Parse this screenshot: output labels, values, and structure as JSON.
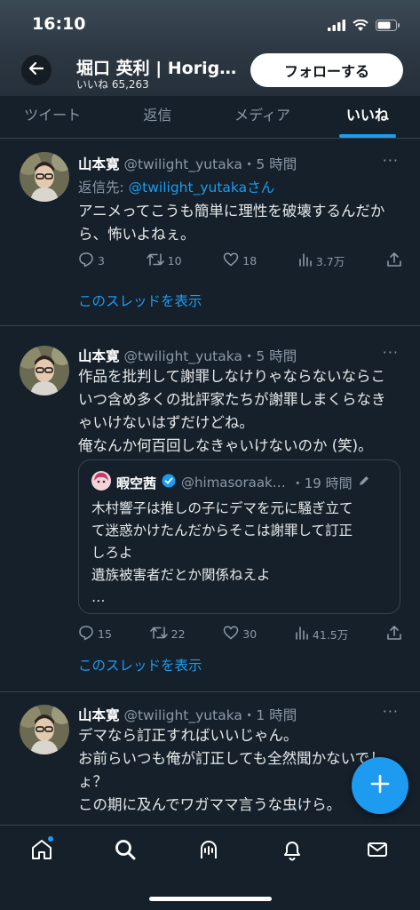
{
  "status_bar": {
    "time": "16:10"
  },
  "header": {
    "profile_name": "堀口 英利 | Horig…",
    "likes_label": "いいね 65,263",
    "follow_label": "フォローする"
  },
  "tabs": [
    {
      "label": "ツイート",
      "active": false
    },
    {
      "label": "返信",
      "active": false
    },
    {
      "label": "メディア",
      "active": false
    },
    {
      "label": "いいね",
      "active": true
    }
  ],
  "tweets": [
    {
      "name": "山本寛",
      "handle": "@twilight_yutaka",
      "time": "・5 時間",
      "more": "···",
      "reply_prefix": "返信先: ",
      "reply_handle": "@twilight_yutakaさん",
      "lines": [
        "アニメってこうも簡単に理性を破壊するんだか",
        "ら、怖いよねぇ。"
      ],
      "replies": "3",
      "retweets": "10",
      "likes": "18",
      "views": "3.7万",
      "thread_label": "このスレッドを表示"
    },
    {
      "name": "山本寛",
      "handle": "@twilight_yutaka",
      "time": "・5 時間",
      "more": "···",
      "lines": [
        "作品を批判して謝罪しなけりゃならないならこ",
        "いつ含め多くの批評家たちが謝罪しまくらなき",
        "ゃいけないはずだけどね。",
        "俺なんか何百回しなきゃいけないのか (笑)。"
      ],
      "quote": {
        "name": "暇空茜",
        "handle": "@himasoraak…",
        "time": "・19 時間",
        "lines": [
          "木村響子は推しの子にデマを元に騒ぎ立て",
          "て迷惑かけたんだからそこは謝罪して訂正",
          "しろよ",
          "遺族被害者だとか関係ねえよ",
          "…"
        ]
      },
      "replies": "15",
      "retweets": "22",
      "likes": "30",
      "views": "41.5万",
      "thread_label": "このスレッドを表示"
    },
    {
      "name": "山本寛",
      "handle": "@twilight_yutaka",
      "time": "・1 時間",
      "more": "···",
      "lines": [
        "デマなら訂正すればいいじゃん。",
        "お前らいつも俺が訂正しても全然聞かないでし",
        "ょ？",
        "この期に及んでワガママ言うな虫けら。"
      ]
    }
  ],
  "colors": {
    "background": "#15202b",
    "accent": "#1d9bf0",
    "muted_text": "#8b98a5",
    "divider": "#38444d"
  },
  "icons": [
    "back-arrow-icon",
    "signal-icon",
    "wifi-icon",
    "battery-icon",
    "reply-icon",
    "retweet-icon",
    "like-icon",
    "views-icon",
    "share-icon",
    "verified-icon",
    "pencil-icon",
    "compose-plus-icon",
    "home-icon",
    "search-icon",
    "spaces-icon",
    "notifications-icon",
    "messages-icon"
  ]
}
